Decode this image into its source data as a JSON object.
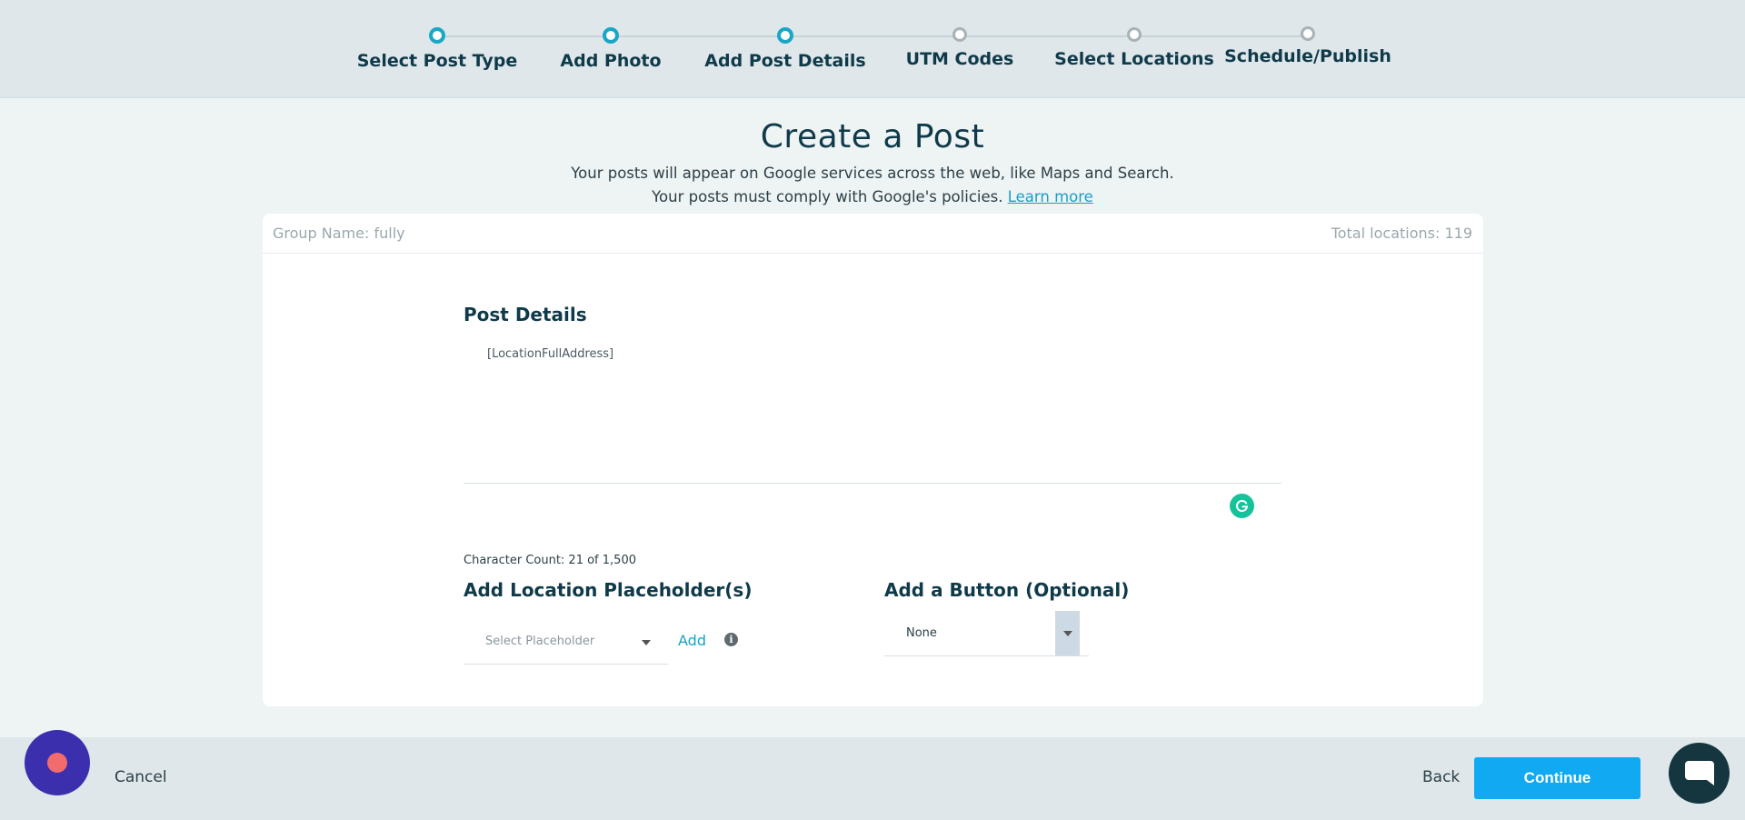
{
  "stepper": {
    "steps": [
      {
        "label": "Select Post Type",
        "state": "complete"
      },
      {
        "label": "Add Photo",
        "state": "complete"
      },
      {
        "label": "Add Post Details",
        "state": "current"
      },
      {
        "label": "UTM Codes",
        "state": "pending"
      },
      {
        "label": "Select Locations",
        "state": "pending"
      },
      {
        "label": "Schedule/Publish",
        "state": "pending"
      }
    ]
  },
  "header": {
    "title": "Create a Post",
    "subtitle_line1": "Your posts will appear on Google services across the web, like Maps and Search.",
    "subtitle_line2": "Your posts must comply with Google's policies.",
    "learn_more": "Learn more"
  },
  "card": {
    "group_name": "Group Name: fully",
    "total_locations": "Total locations: 119",
    "post_details_title": "Post Details",
    "post_text": "[LocationFullAddress]",
    "char_count": "Character Count: 21 of 1,500",
    "placeholder_title": "Add Location Placeholder(s)",
    "placeholder_select": "Select Placeholder",
    "add_label": "Add",
    "info_glyph": "i",
    "button_title": "Add a Button (Optional)",
    "button_select": "None"
  },
  "footer": {
    "cancel": "Cancel",
    "back": "Back",
    "continue": "Continue"
  },
  "colors": {
    "accent": "#18a7c4",
    "primary_button": "#10a9f2",
    "record_button": "#3b2fad",
    "grammarly": "#15c39a"
  },
  "icons": [
    "grammarly-icon",
    "info-icon",
    "chevron-down-icon",
    "record-icon",
    "chat-icon"
  ]
}
